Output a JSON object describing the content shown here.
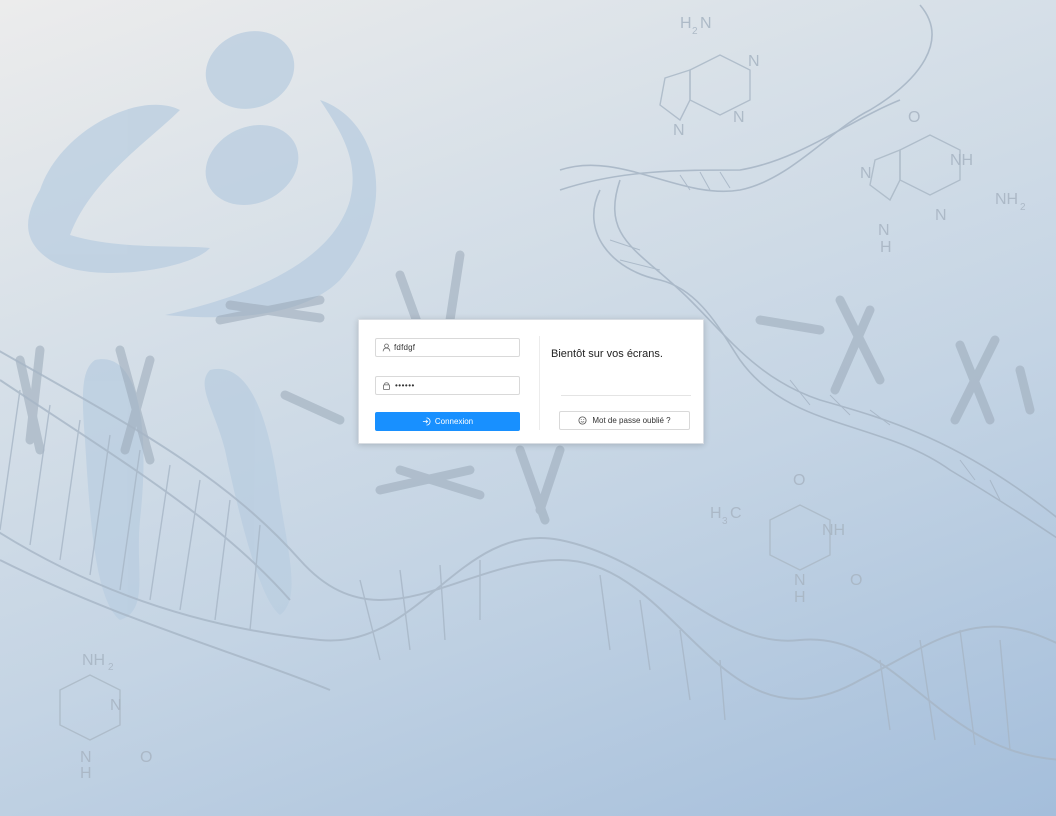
{
  "login": {
    "username_value": "fdfdgf",
    "password_value": "••••••",
    "login_button_label": "Connexion",
    "user_icon": "user-icon",
    "lock_icon": "lock-icon",
    "login_icon": "login-icon"
  },
  "info": {
    "title": "Bientôt sur vos écrans.",
    "forgot_button_label": "Mot de passe oublié ?",
    "forgot_icon": "smile-icon"
  },
  "background": {
    "molecule_labels": [
      "H2N",
      "N",
      "N",
      "N",
      "NH",
      "O",
      "NH2",
      "NH",
      "H3C",
      "O",
      "NH2",
      "N",
      "O",
      "H"
    ]
  },
  "colors": {
    "primary": "#1890ff",
    "background_start": "#ececec",
    "background_end": "#a4bedb"
  }
}
